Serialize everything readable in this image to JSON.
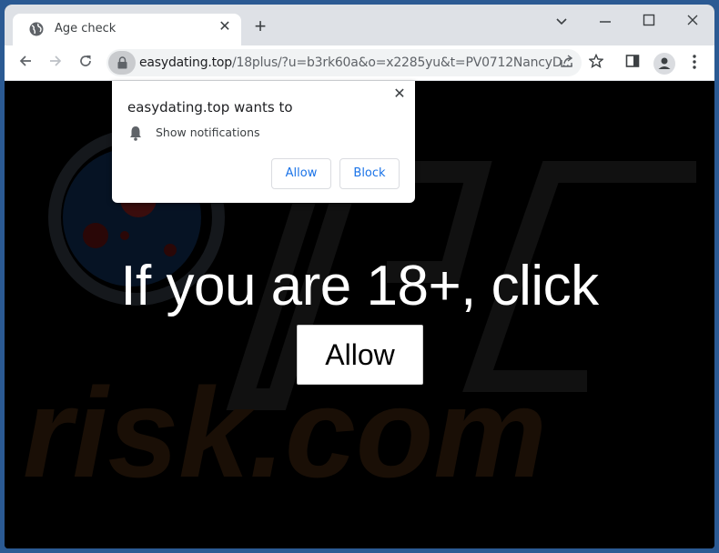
{
  "browser": {
    "tab": {
      "title": "Age check",
      "icon": "globe-icon"
    },
    "new_tab_symbol": "+",
    "window_controls": {
      "tab_search": "⌄",
      "minimize": "—",
      "maximize": "☐",
      "close": "✕"
    },
    "address_bar": {
      "domain": "easydating.top",
      "path": "/18plus/?u=b3rk60a&o=x2285yu&t=PV0712NancyD..."
    }
  },
  "permission_popup": {
    "title": "easydating.top wants to",
    "permission": "Show notifications",
    "allow_label": "Allow",
    "block_label": "Block",
    "close_symbol": "✕"
  },
  "page": {
    "headline": "If you are 18+, click",
    "allow_button_label": "Allow",
    "watermark_text": "risk.com",
    "accent_color": "#1a73e8"
  }
}
